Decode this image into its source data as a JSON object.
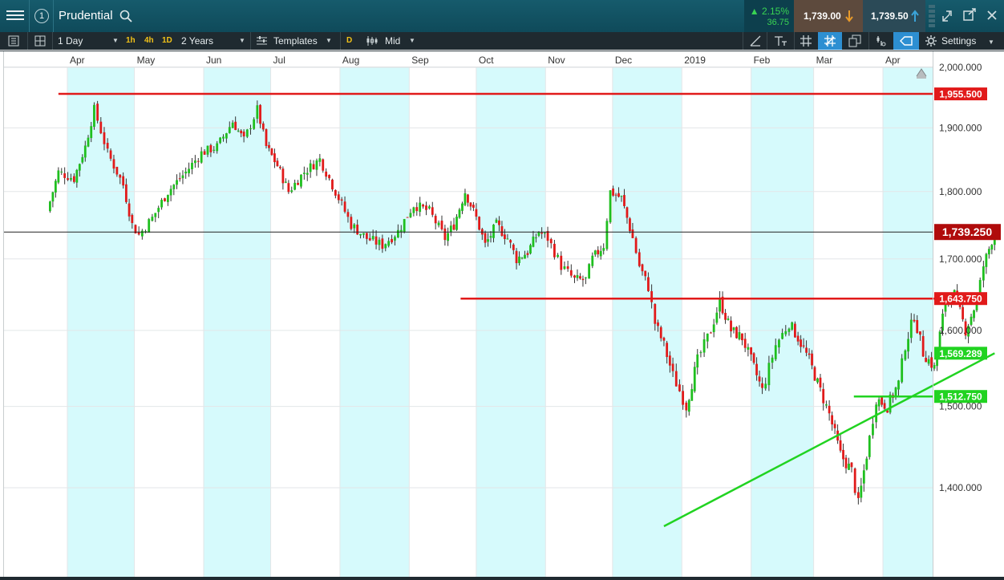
{
  "header": {
    "menu_count": "1",
    "instrument": "Prudential",
    "change_pct": "▲ 2.15%",
    "change_abs": "36.75",
    "sell_price": "1,739.00",
    "buy_price": "1,739.50"
  },
  "toolbar": {
    "interval": "1 Day",
    "quick_intervals": [
      "1h",
      "4h",
      "1D"
    ],
    "range": "2 Years",
    "templates_label": "Templates",
    "d_label": "D",
    "price_mode": "Mid",
    "settings_label": "Settings"
  },
  "colors": {
    "up": "#1fbf1f",
    "down": "#e11a1a",
    "shade": "#d6fafc",
    "level_red": "#e11a1a",
    "level_green": "#21d321",
    "current_label": "#b00b0b"
  },
  "chart_data": {
    "type": "candlestick",
    "title": "",
    "xlabel": "",
    "ylabel": "",
    "ylim": [
      1310,
      2010
    ],
    "yticks": [
      {
        "value": 2000,
        "label": "2,000.000"
      },
      {
        "value": 1900,
        "label": "1,900.000"
      },
      {
        "value": 1800,
        "label": "1,800.000"
      },
      {
        "value": 1700,
        "label": "1,700.000"
      },
      {
        "value": 1600,
        "label": "1,600.000"
      },
      {
        "value": 1500,
        "label": "1,500.000"
      },
      {
        "value": 1400,
        "label": "1,400.000"
      }
    ],
    "months": [
      {
        "label": "Apr",
        "date": "2018-04"
      },
      {
        "label": "May",
        "date": "2018-05"
      },
      {
        "label": "Jun",
        "date": "2018-06"
      },
      {
        "label": "Jul",
        "date": "2018-07"
      },
      {
        "label": "Aug",
        "date": "2018-08"
      },
      {
        "label": "Sep",
        "date": "2018-09"
      },
      {
        "label": "Oct",
        "date": "2018-10"
      },
      {
        "label": "Nov",
        "date": "2018-11"
      },
      {
        "label": "Dec",
        "date": "2018-12"
      },
      {
        "label": "2019",
        "date": "2019-01"
      },
      {
        "label": "Feb",
        "date": "2019-02"
      },
      {
        "label": "Mar",
        "date": "2019-03"
      },
      {
        "label": "Apr",
        "date": "2019-04"
      }
    ],
    "close_path": [
      [
        "2018-03-23",
        1770
      ],
      [
        "2018-03-28",
        1830
      ],
      [
        "2018-04-04",
        1820
      ],
      [
        "2018-04-09",
        1870
      ],
      [
        "2018-04-13",
        1930
      ],
      [
        "2018-04-19",
        1860
      ],
      [
        "2018-04-26",
        1810
      ],
      [
        "2018-04-30",
        1750
      ],
      [
        "2018-05-03",
        1735
      ],
      [
        "2018-05-09",
        1760
      ],
      [
        "2018-05-16",
        1800
      ],
      [
        "2018-05-24",
        1830
      ],
      [
        "2018-05-31",
        1860
      ],
      [
        "2018-06-07",
        1870
      ],
      [
        "2018-06-14",
        1910
      ],
      [
        "2018-06-19",
        1880
      ],
      [
        "2018-06-25",
        1930
      ],
      [
        "2018-06-29",
        1870
      ],
      [
        "2018-07-04",
        1840
      ],
      [
        "2018-07-09",
        1800
      ],
      [
        "2018-07-16",
        1830
      ],
      [
        "2018-07-23",
        1850
      ],
      [
        "2018-07-30",
        1800
      ],
      [
        "2018-08-06",
        1750
      ],
      [
        "2018-08-13",
        1730
      ],
      [
        "2018-08-20",
        1720
      ],
      [
        "2018-08-27",
        1740
      ],
      [
        "2018-09-03",
        1780
      ],
      [
        "2018-09-10",
        1770
      ],
      [
        "2018-09-17",
        1730
      ],
      [
        "2018-09-21",
        1750
      ],
      [
        "2018-09-26",
        1800
      ],
      [
        "2018-10-01",
        1760
      ],
      [
        "2018-10-05",
        1720
      ],
      [
        "2018-10-10",
        1750
      ],
      [
        "2018-10-15",
        1730
      ],
      [
        "2018-10-19",
        1700
      ],
      [
        "2018-10-24",
        1710
      ],
      [
        "2018-10-29",
        1740
      ],
      [
        "2018-11-02",
        1730
      ],
      [
        "2018-11-08",
        1690
      ],
      [
        "2018-11-14",
        1670
      ],
      [
        "2018-11-19",
        1670
      ],
      [
        "2018-11-22",
        1700
      ],
      [
        "2018-11-27",
        1720
      ],
      [
        "2018-11-30",
        1800
      ],
      [
        "2018-12-05",
        1790
      ],
      [
        "2018-12-10",
        1730
      ],
      [
        "2018-12-13",
        1690
      ],
      [
        "2018-12-17",
        1660
      ],
      [
        "2018-12-20",
        1610
      ],
      [
        "2018-12-24",
        1580
      ],
      [
        "2018-12-28",
        1540
      ],
      [
        "2019-01-03",
        1500
      ],
      [
        "2019-01-08",
        1560
      ],
      [
        "2019-01-14",
        1600
      ],
      [
        "2019-01-18",
        1640
      ],
      [
        "2019-01-23",
        1600
      ],
      [
        "2019-01-28",
        1590
      ],
      [
        "2019-02-01",
        1560
      ],
      [
        "2019-02-06",
        1520
      ],
      [
        "2019-02-12",
        1580
      ],
      [
        "2019-02-18",
        1610
      ],
      [
        "2019-02-22",
        1590
      ],
      [
        "2019-02-27",
        1560
      ],
      [
        "2019-03-04",
        1520
      ],
      [
        "2019-03-08",
        1490
      ],
      [
        "2019-03-13",
        1440
      ],
      [
        "2019-03-18",
        1420
      ],
      [
        "2019-03-21",
        1380
      ],
      [
        "2019-03-26",
        1460
      ],
      [
        "2019-03-29",
        1510
      ],
      [
        "2019-04-03",
        1500
      ],
      [
        "2019-04-08",
        1530
      ],
      [
        "2019-04-11",
        1580
      ],
      [
        "2019-04-15",
        1620
      ],
      [
        "2019-04-19",
        1570
      ],
      [
        "2019-04-24",
        1550
      ],
      [
        "2019-04-29",
        1640
      ],
      [
        "2019-05-03",
        1650
      ],
      [
        "2019-05-08",
        1600
      ],
      [
        "2019-05-13",
        1640
      ],
      [
        "2019-05-16",
        1690
      ],
      [
        "2019-05-21",
        1739.25
      ]
    ],
    "levels": [
      {
        "value": 1955.5,
        "label": "1,955.500",
        "color": "red",
        "style": "solid",
        "from": "2018-03-28",
        "to": "2019-05-21"
      },
      {
        "value": 1643.75,
        "label": "1,643.750",
        "color": "red",
        "style": "solid-then-dashed",
        "from": "2018-09-24",
        "to": "2019-05-21"
      },
      {
        "value": 1512.75,
        "label": "1,512.750",
        "color": "green",
        "style": "solid",
        "from": "2019-03-19",
        "to": "2019-05-21"
      }
    ],
    "trendline": {
      "from": {
        "date": "2018-12-24",
        "value": 1355
      },
      "to": {
        "date": "2019-05-21",
        "value": 1569.289
      },
      "label": "1,569.289",
      "color": "green"
    },
    "current_price": {
      "value": 1739.25,
      "label": "1,739.250"
    },
    "grid": true
  }
}
